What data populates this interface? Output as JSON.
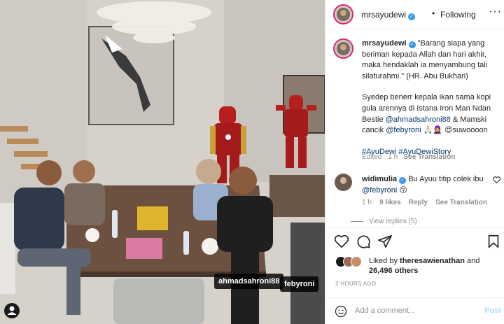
{
  "photo": {
    "tags": [
      "ahmadsahroni88",
      "febyroni"
    ],
    "tag_icon": "person-tag-icon"
  },
  "header": {
    "username": "mrsayudewi",
    "separator": "•",
    "follow_status": "Following",
    "more_icon": "more-options-icon"
  },
  "caption": {
    "username": "mrsayudewi",
    "quote": "\"Barang siapa yang beriman kepada Allah dan hari akhir, maka hendaklah ia menyambung tali silaturahmi.\" (HR. Abu Bukhari)",
    "body_part1": "Syedep benerr kepala ikan sama kopi gula arennya di Istana Iron Man Ndan Bestie",
    "mention1": "@ahmadsahroni88",
    "body_part2": "& Mamski cancik",
    "mention2": "@febyroni",
    "emojis": "🙏🏻🧕 😍",
    "body_part3": "suwoooon",
    "hashtag1": "#AyuDewi",
    "hashtag2": "#AyuDewiStory",
    "status": "Edited",
    "time": "1 h",
    "translate": "See Translation"
  },
  "comment": {
    "username": "widimulia",
    "text": "Bu Ayuu titip colek ibu",
    "mention": "@febyroni",
    "emoji": "😚",
    "time": "1 h",
    "likes": "9 likes",
    "reply": "Reply",
    "translate": "See Translation",
    "view_replies": "View replies (5)"
  },
  "likes": {
    "prefix": "Liked by",
    "user": "theresawienathan",
    "middle": "and",
    "count": "26,496 others"
  },
  "time_ago": "2 HOURS AGO",
  "add_comment": {
    "placeholder": "Add a comment...",
    "post_label": "Post"
  },
  "colors": {
    "link": "#00376b",
    "verified": "#3897f0",
    "post_disabled": "#b2dffc",
    "muted": "#8e8e8e"
  }
}
